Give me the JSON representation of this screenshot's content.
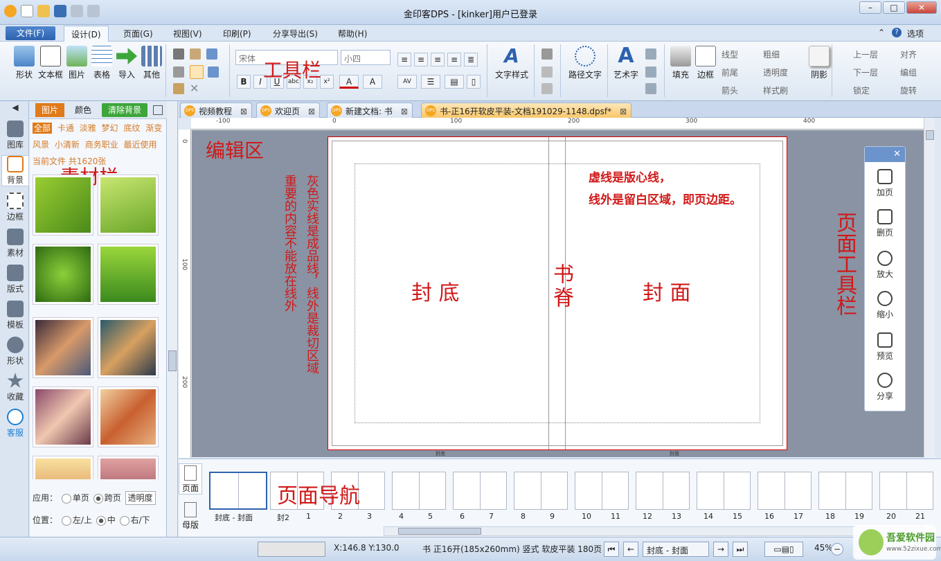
{
  "window": {
    "title": "金印客DPS - [kinker]用户已登录"
  },
  "menu": {
    "file": "文件(F)",
    "design": "设计(D)",
    "page": "页面(G)",
    "view": "视图(V)",
    "print": "印刷(P)",
    "share": "分享导出(S)",
    "help": "帮助(H)",
    "options": "选项"
  },
  "ribbon": {
    "insert": [
      "形状",
      "文本框",
      "图片",
      "表格",
      "导入",
      "其他"
    ],
    "font_placeholder": "宋体",
    "size_placeholder": "小四",
    "text_style": "文字样式",
    "path_text": "路径文字",
    "art_text": "艺术字",
    "fill": "填充",
    "border": "边框",
    "line_type": "线型",
    "thickness": "粗细",
    "front_end": "前尾",
    "transparency": "透明度",
    "arrow": "箭头",
    "style_brush": "样式刷",
    "shadow": "阴影",
    "up_layer": "上一层",
    "down_layer": "下一层",
    "lock": "锁定",
    "align": "对齐",
    "group": "编组",
    "rotate": "旋转"
  },
  "sidebar": [
    "图库",
    "背景",
    "边框",
    "素材",
    "版式",
    "模板",
    "形状",
    "收藏",
    "客服"
  ],
  "material": {
    "tabs": [
      "图片",
      "颜色"
    ],
    "clear_bg": "清除背景",
    "categories_row1": [
      "全部",
      "卡通",
      "淡雅",
      "梦幻",
      "底纹",
      "渐变"
    ],
    "categories_row2": [
      "风景",
      "小清新",
      "商务职业",
      "最近使用"
    ],
    "count": "当前文件 共1620张",
    "apply_label": "应用：",
    "single_page": "单页",
    "cross_page": "跨页",
    "transparency_btn": "透明度",
    "position_label": "位置：",
    "pos_left": "左/上",
    "pos_center": "中",
    "pos_right": "右/下"
  },
  "doc_tabs": [
    "视频教程",
    "欢迎页",
    "新建文档: 书",
    "书-正16开软皮平装-文档191029-1148.dpsf*"
  ],
  "ruler": {
    "h": [
      "-100",
      "0",
      "100",
      "200",
      "300",
      "400"
    ],
    "v": [
      "0",
      "100",
      "200"
    ]
  },
  "annotations": {
    "toolbar": "工具栏",
    "edit_area": "编辑区",
    "material_bar": "素材栏",
    "page_toolbar": "页面工具栏",
    "page_nav": "页面导航",
    "gray_line": "灰色实线是成品线，线外是裁切区域",
    "important": "重要的内容不能放在线外",
    "dotted_line": "虚线是版心线，",
    "margin_note": "线外是留白区域，即页边距。",
    "back_cover": "封 底",
    "spine": "书脊",
    "front_cover": "封 面",
    "page_footer_left": "封底",
    "page_footer_right": "封面"
  },
  "page_tools": [
    "加页",
    "删页",
    "放大",
    "缩小",
    "预览",
    "分享"
  ],
  "nav": {
    "side_page": "页面",
    "side_master": "母版",
    "labels": [
      "封底 - 封面",
      "封2",
      "1",
      "2",
      "3",
      "4",
      "5",
      "6",
      "7",
      "8",
      "9",
      "10",
      "11",
      "12",
      "13",
      "14",
      "15",
      "16",
      "17",
      "18",
      "19",
      "20",
      "21"
    ]
  },
  "status": {
    "coords": "X:146.8  Y:130.0",
    "book_info": "书 正16开(185x260mm) 竖式 软皮平装 180页",
    "page_select": "封底 - 封面",
    "zoom": "45%"
  },
  "watermark": {
    "name": "吾爱软件园",
    "url": "www.52zixue.com"
  },
  "colors": {
    "accent": "#d01818",
    "brand_blue": "#2d62ae",
    "orange": "#f5a623"
  }
}
